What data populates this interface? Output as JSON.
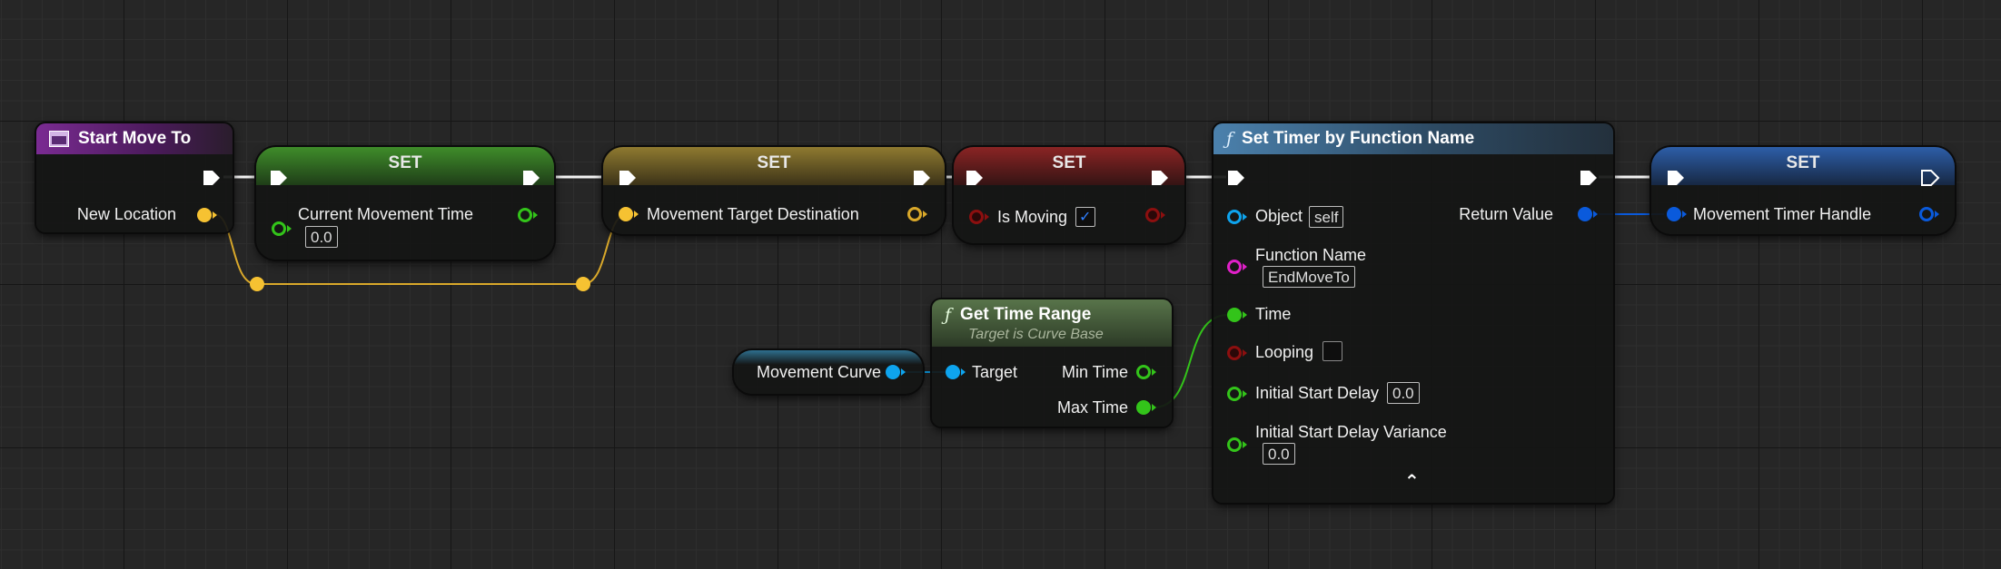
{
  "nodes": {
    "start_move_to": {
      "title": "Start Move To",
      "pin_new_location": "New Location"
    },
    "set_movement_time": {
      "title": "SET",
      "pin_label": "Current Movement Time",
      "value": "0.0"
    },
    "set_target_destination": {
      "title": "SET",
      "pin_label": "Movement Target Destination"
    },
    "set_is_moving": {
      "title": "SET",
      "pin_label": "Is Moving",
      "checked": "✓"
    },
    "set_timer": {
      "title": "Set Timer by Function Name",
      "object_label": "Object",
      "object_value": "self",
      "function_name_label": "Function Name",
      "function_name_value": "EndMoveTo",
      "time_label": "Time",
      "looping_label": "Looping",
      "initial_delay_label": "Initial Start Delay",
      "initial_delay_value": "0.0",
      "initial_delay_variance_label": "Initial Start Delay Variance",
      "initial_delay_variance_value": "0.0",
      "return_value_label": "Return Value",
      "collapse_glyph": "⌃"
    },
    "set_timer_handle": {
      "title": "SET",
      "pin_label": "Movement Timer Handle"
    },
    "get_time_range": {
      "title": "Get Time Range",
      "subtitle": "Target is Curve Base",
      "target_label": "Target",
      "min_time_label": "Min Time",
      "max_time_label": "Max Time"
    },
    "movement_curve": {
      "label": "Movement Curve"
    }
  },
  "colors": {
    "exec": "#ffffff",
    "vector": "#f6c232",
    "float": "#33c41a",
    "bool": "#8c0f0f",
    "object": "#0ea4ee",
    "string": "#e020c8",
    "struct": "#0a5adc"
  }
}
